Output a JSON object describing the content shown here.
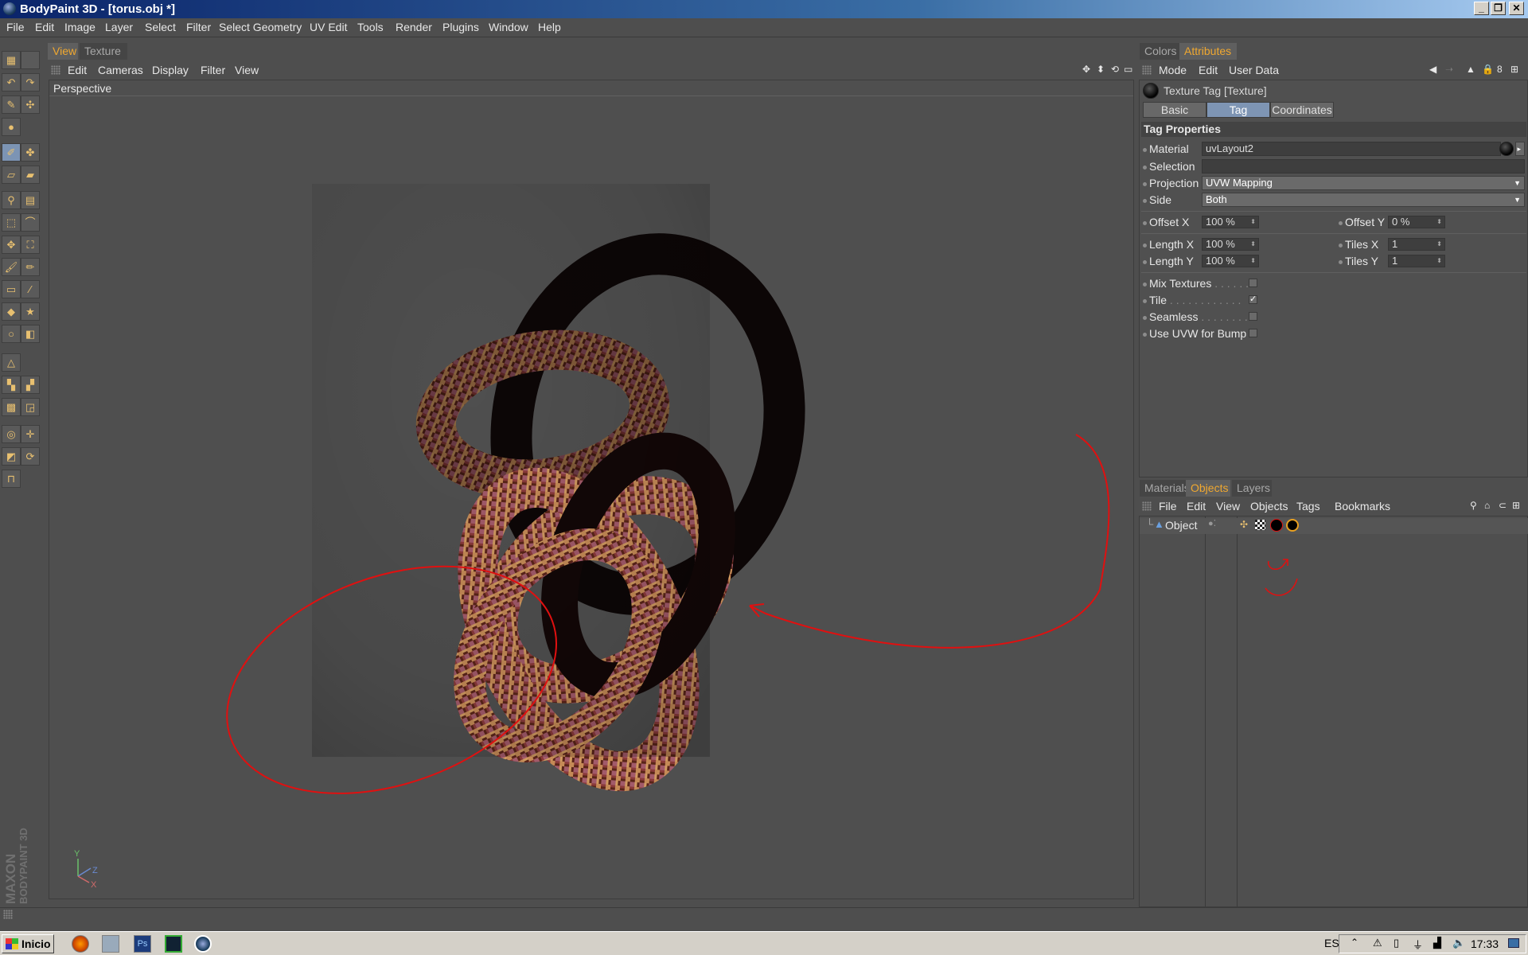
{
  "window": {
    "title": "BodyPaint 3D - [torus.obj *]"
  },
  "menubar": [
    "File",
    "Edit",
    "Image",
    "Layer",
    "Select",
    "Filter",
    "Select Geometry",
    "UV Edit",
    "Tools",
    "Render",
    "Plugins",
    "Window",
    "Help"
  ],
  "viewport": {
    "tabs": [
      "View",
      "Texture"
    ],
    "menu": [
      "Edit",
      "Cameras",
      "Display",
      "Filter",
      "View"
    ],
    "camera_label": "Perspective",
    "axis_labels": {
      "x": "X",
      "y": "Y",
      "z": "Z"
    },
    "watermark": [
      "MAXON",
      "BODYPAINT 3D"
    ]
  },
  "attributes": {
    "panel_tabs": [
      "Colors",
      "Attributes"
    ],
    "menu": [
      "Mode",
      "Edit",
      "User Data"
    ],
    "object_title": "Texture Tag [Texture]",
    "subtabs": [
      "Basic",
      "Tag",
      "Coordinates"
    ],
    "section": "Tag Properties",
    "material_label": "Material",
    "material_value": "uvLayout2",
    "selection_label": "Selection",
    "selection_value": "",
    "projection_label": "Projection",
    "projection_value": "UVW Mapping",
    "side_label": "Side",
    "side_value": "Both",
    "offset_x_label": "Offset X",
    "offset_x_value": "100 %",
    "offset_y_label": "Offset Y",
    "offset_y_value": "0 %",
    "length_x_label": "Length X",
    "length_x_value": "100 %",
    "tiles_x_label": "Tiles X",
    "tiles_x_value": "1",
    "length_y_label": "Length Y",
    "length_y_value": "100 %",
    "tiles_y_label": "Tiles Y",
    "tiles_y_value": "1",
    "mix_textures_label": "Mix Textures",
    "mix_textures": false,
    "tile_label": "Tile",
    "tile": true,
    "seamless_label": "Seamless",
    "seamless": false,
    "uvw_bump_label": "Use UVW for Bump",
    "uvw_bump": false
  },
  "objects": {
    "panel_tabs": [
      "Materials",
      "Objects",
      "Layers"
    ],
    "menu": [
      "File",
      "Edit",
      "View",
      "Objects",
      "Tags",
      "Bookmarks"
    ],
    "items": [
      {
        "name": "Object"
      }
    ]
  },
  "taskbar": {
    "start_label": "Inicio",
    "language": "ES",
    "clock": "17:33"
  },
  "colors": {
    "accent_orange": "#f0a830",
    "active_blue": "#7e95b4",
    "annotation_red": "#e01010"
  }
}
